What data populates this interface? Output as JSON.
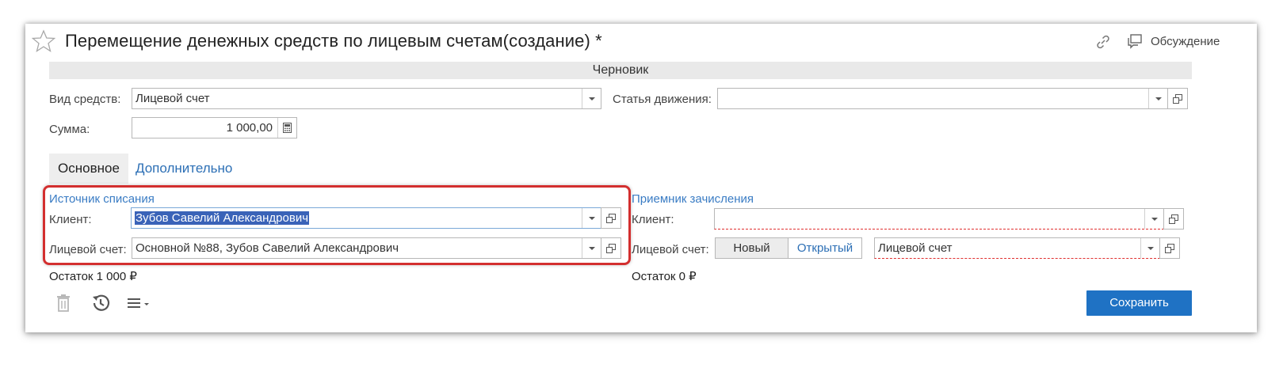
{
  "header": {
    "title": "Перемещение денежных средств по лицевым счетам(создание) *",
    "discussion_label": "Обсуждение"
  },
  "status": "Черновик",
  "form": {
    "vid_label": "Вид средств:",
    "vid_value": "Лицевой счет",
    "statya_label": "Статья движения:",
    "statya_value": "",
    "summa_label": "Сумма:",
    "summa_value": "1 000,00"
  },
  "tabs": [
    {
      "label": "Основное",
      "active": true
    },
    {
      "label": "Дополнительно",
      "active": false
    }
  ],
  "source": {
    "title": "Источник списания",
    "client_label": "Клиент:",
    "client_value": "Зубов Савелий Александрович",
    "account_label": "Лицевой счет:",
    "account_value": "Основной №88, Зубов Савелий Александрович",
    "balance": "Остаток 1 000 ₽"
  },
  "target": {
    "title": "Приемник зачисления",
    "client_label": "Клиент:",
    "client_value": "",
    "account_label": "Лицевой счет:",
    "btn_new": "Новый",
    "btn_open": "Открытый",
    "account_placeholder": "Лицевой счет",
    "balance": "Остаток 0 ₽"
  },
  "footer": {
    "save_label": "Сохранить"
  },
  "icons": [
    "star-icon",
    "link-icon",
    "discussion-icon",
    "calculator-icon",
    "trash-icon",
    "history-icon",
    "menu-icon",
    "open-window-icon",
    "chevron-down-icon"
  ],
  "colors": {
    "accent": "#1f72c4",
    "link": "#2c6fb5",
    "highlight": "#d32f2f",
    "selection": "#3a63b8"
  }
}
